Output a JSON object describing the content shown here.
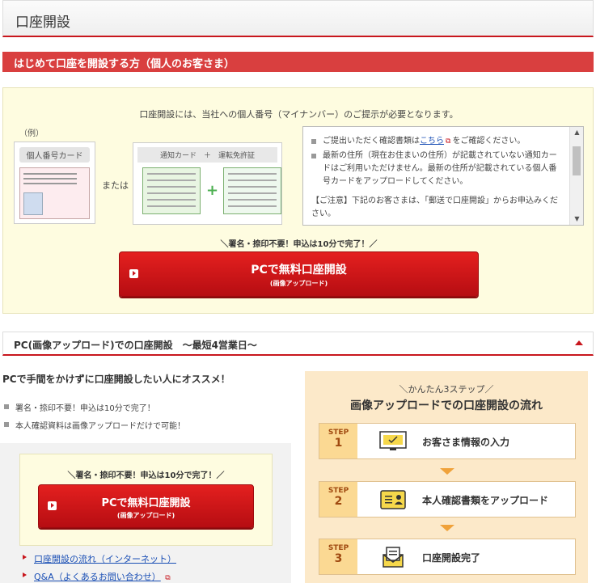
{
  "page": {
    "title": "口座開設"
  },
  "section": {
    "title": "はじめて口座を開設する方（個人のお客さま）"
  },
  "intro": {
    "notice": "口座開設には、当社への個人番号（マイナンバー）のご提示が必要となります。",
    "example_label": "（例）",
    "card1_title": "個人番号カード",
    "or_text": "または",
    "card2_title": "通知カード　＋　運転免許証"
  },
  "info": {
    "item1_pre": "ご提出いただく確認書類は",
    "item1_link": "こちら",
    "item1_post": "をご確認ください。",
    "item2": "最新の住所（現在お住まいの住所）が記載されていない通知カードはご利用いただけません。最新の住所が記載されている個人番号カードをアップロードしてください。",
    "caution": "【ご注意】下記のお客さまは、「郵送で口座開設」からお申込みください。"
  },
  "cta": {
    "tagline": "＼署名・捺印不要！申込は10分で完了！／",
    "main": "PCで無料口座開設",
    "sub": "(画像アップロード)"
  },
  "pc_section": {
    "title": "PC(画像アップロード)での口座開設　～最短4営業日～",
    "recommend": "PCで手間をかけずに口座開設したい人にオススメ！",
    "points": [
      "署名・捺印不要！申込は10分で完了！",
      "本人確認資料は画像アップロードだけで可能！"
    ],
    "links": [
      "口座開設の流れ（インターネット）",
      "Q&A（よくあるお問い合わせ）"
    ]
  },
  "steps": {
    "tag": "＼かんたん3ステップ／",
    "title": "画像アップロードでの口座開設の流れ",
    "word": "STEP",
    "items": [
      {
        "num": "1",
        "label": "お客さま情報の入力",
        "icon": "monitor-check-icon"
      },
      {
        "num": "2",
        "label": "本人確認書類をアップロード",
        "icon": "id-card-icon"
      },
      {
        "num": "3",
        "label": "口座開設完了",
        "icon": "envelope-document-icon"
      }
    ]
  },
  "colors": {
    "brand_red": "#c8161d",
    "section_red": "#d93f3f",
    "panel_yellow": "#fefce0",
    "steps_bg": "#fce9c9",
    "link": "#1a4fb5"
  }
}
